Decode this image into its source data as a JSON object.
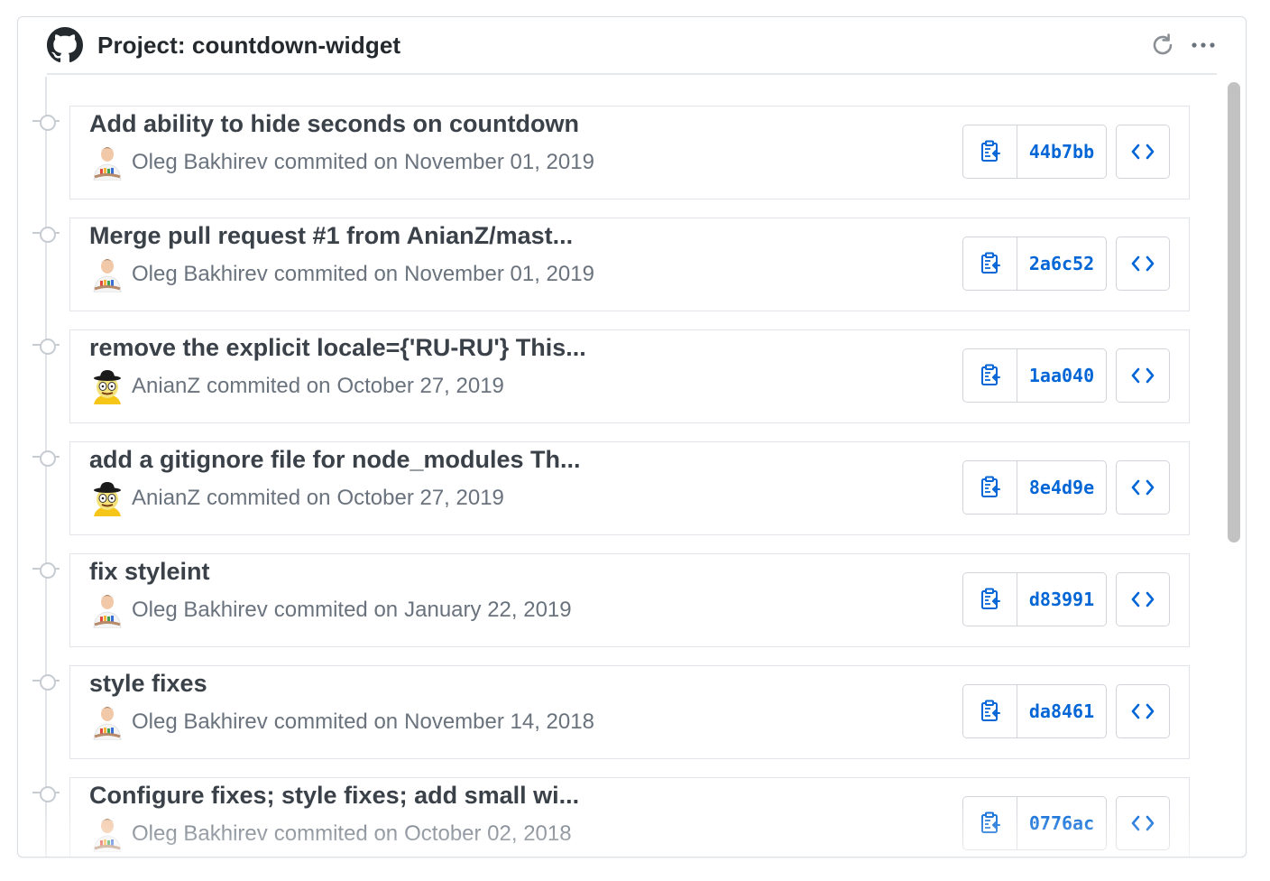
{
  "project": {
    "title": "Project: countdown-widget"
  },
  "icons": {
    "logo": "github-octocat-icon",
    "refresh": "refresh-icon",
    "more": "ellipsis-icon",
    "copy": "clipboard-copy-icon",
    "browse": "code-brackets-icon"
  },
  "colors": {
    "sha_link": "#0366d6",
    "text_primary": "#3a4148",
    "text_muted": "#6a737d",
    "border": "#e1e4e8"
  },
  "connector_word": "commited on",
  "commits": [
    {
      "message": "Add ability to hide seconds on countdown",
      "author": "Oleg Bakhirev",
      "date": "November 01, 2019",
      "sha": "44b7bb",
      "avatar": "oleg"
    },
    {
      "message": "Merge pull request #1 from AnianZ/mast...",
      "author": "Oleg Bakhirev",
      "date": "November 01, 2019",
      "sha": "2a6c52",
      "avatar": "oleg"
    },
    {
      "message": "remove the explicit locale={'RU-RU'} This...",
      "author": "AnianZ",
      "date": "October 27, 2019",
      "sha": "1aa040",
      "avatar": "anianz"
    },
    {
      "message": "add a gitignore file for node_modules Th...",
      "author": "AnianZ",
      "date": "October 27, 2019",
      "sha": "8e4d9e",
      "avatar": "anianz"
    },
    {
      "message": "fix styleint",
      "author": "Oleg Bakhirev",
      "date": "January 22, 2019",
      "sha": "d83991",
      "avatar": "oleg"
    },
    {
      "message": "style fixes",
      "author": "Oleg Bakhirev",
      "date": "November 14, 2018",
      "sha": "da8461",
      "avatar": "oleg"
    },
    {
      "message": "Configure fixes; style fixes; add small wi...",
      "author": "Oleg Bakhirev",
      "date": "October 02, 2018",
      "sha": "0776ac",
      "avatar": "oleg"
    }
  ]
}
